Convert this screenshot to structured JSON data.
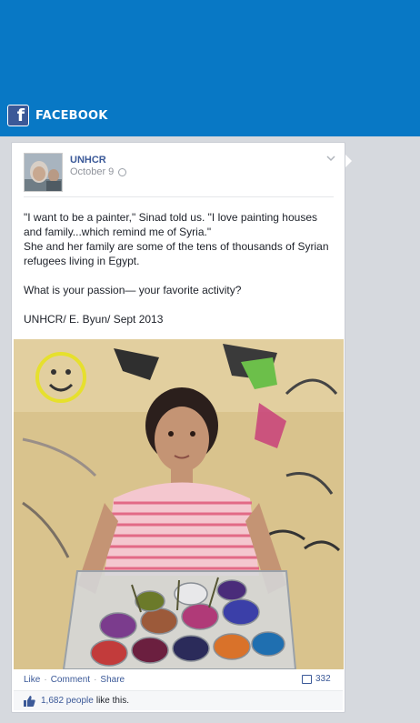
{
  "header": {
    "title": "FACEBOOK",
    "logo_letter": "f",
    "band_color": "#0878c5",
    "brand_color": "#3b5998"
  },
  "post": {
    "page_name": "UNHCR",
    "date": "October 9",
    "text_lines": [
      "\"I want to be a painter,\" Sinad told us. \"I love painting houses and family...which remind me of Syria.\"",
      "She and her family are some of the tens of thousands of Syrian refugees living in Egypt."
    ],
    "question": "What is your passion— your favorite activity?",
    "credit": "UNHCR/ E. Byun/ Sept 2013"
  },
  "actions": {
    "like_label": "Like",
    "comment_label": "Comment",
    "share_label": "Share",
    "separator": "·",
    "comment_count": "332"
  },
  "likes": {
    "count": "1,682 people",
    "suffix": "like this."
  }
}
